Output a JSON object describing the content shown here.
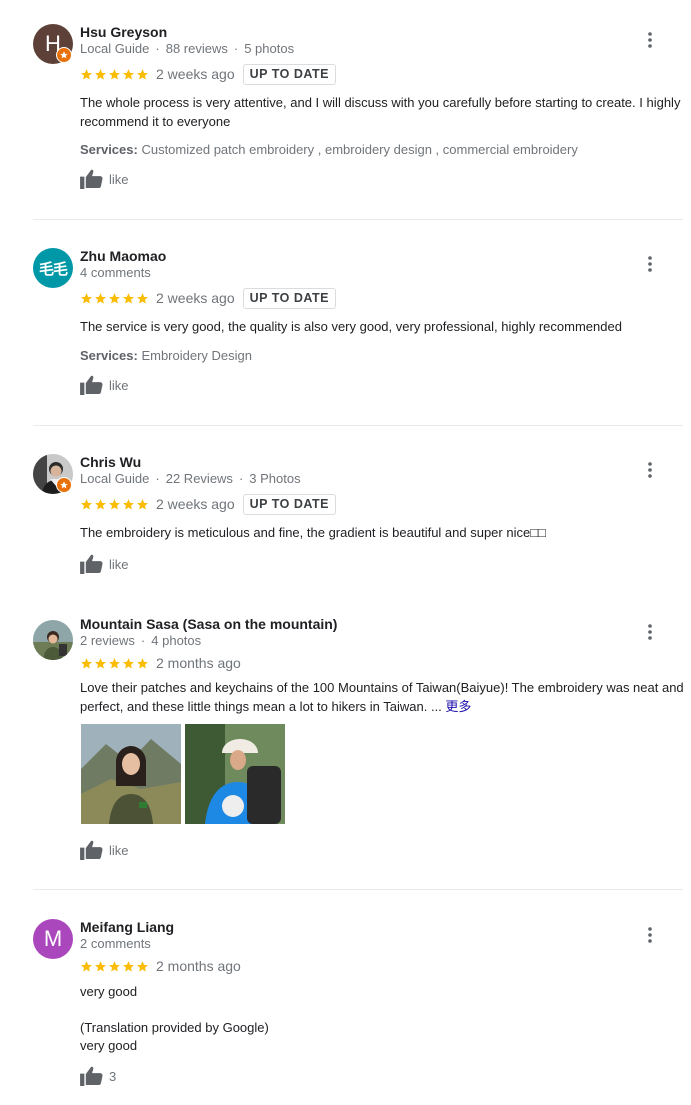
{
  "colors": {
    "star": "#fbbc04",
    "local_guide_badge": "#e8710a",
    "avatar_hsu": "#5d4037",
    "avatar_zhu": "#0097a7",
    "avatar_meifang": "#ab47bc"
  },
  "reviews": [
    {
      "avatar_letter": "H",
      "name": "Hsu Greyson",
      "meta": [
        "Local Guide",
        "88 reviews",
        "5 photos"
      ],
      "rating": 5,
      "date": "2 weeks ago",
      "badge": "UP TO DATE",
      "text": "The whole process is very attentive, and I will discuss with you carefully before starting to create. I highly recommend it to everyone",
      "services_label": "Services:",
      "services": "Customized patch embroidery ,  embroidery design ,  commercial embroidery",
      "like_label": "like"
    },
    {
      "avatar_letter": "毛毛",
      "name": "Zhu Maomao",
      "meta": [
        "4 comments"
      ],
      "rating": 5,
      "date": "2 weeks ago",
      "badge": "UP TO DATE",
      "text": "The service is very good, the quality is also very good, very professional, highly recommended",
      "services_label": "Services:",
      "services": "Embroidery Design",
      "like_label": "like"
    },
    {
      "name": "Chris Wu",
      "meta": [
        "Local Guide",
        "22 Reviews",
        "3 Photos"
      ],
      "rating": 5,
      "date": "2 weeks ago",
      "badge": "UP TO DATE",
      "text": "The embroidery is meticulous and fine, the gradient is beautiful and super nice□□",
      "like_label": "like"
    },
    {
      "name": "Mountain Sasa (Sasa on the mountain)",
      "meta": [
        "2 reviews",
        "4 photos"
      ],
      "rating": 5,
      "date": "2 months ago",
      "text": "Love their patches and keychains of the 100 Mountains of Taiwan(Baiyue)! The embroidery was neat and perfect, and these little things mean a lot to hikers in Taiwan. ...",
      "more_label": "更多",
      "like_label": "like"
    },
    {
      "avatar_letter": "M",
      "name": "Meifang Liang",
      "meta": [
        "2 comments"
      ],
      "rating": 5,
      "date": "2 months ago",
      "text": "very good",
      "translation_note": "(Translation provided by Google)",
      "translated_text": "very good",
      "like_count": "3"
    }
  ]
}
